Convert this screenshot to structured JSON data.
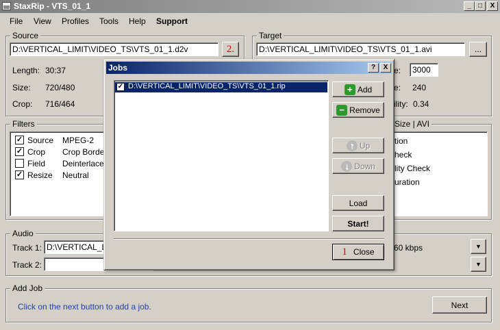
{
  "window": {
    "title": "StaxRip - VTS_01_1",
    "buttons": {
      "minimize": "_",
      "maximize": "□",
      "close": "X"
    }
  },
  "menu": [
    "File",
    "View",
    "Profiles",
    "Tools",
    "Help",
    "Support"
  ],
  "source": {
    "label": "Source",
    "path": "D:\\VERTICAL_LIMIT\\VIDEO_TS\\VTS_01_1.d2v",
    "browse_label": "2.",
    "length_label": "Length:",
    "length_value": "30:37",
    "size_label": "Size:",
    "size_value": "720/480",
    "crop_label": "Crop:",
    "crop_value": "716/464"
  },
  "target": {
    "label": "Target",
    "path": "D:\\VERTICAL_LIMIT\\VIDEO_TS\\VTS_01_1.avi",
    "browse_label": "...",
    "bitrate_label": "e:",
    "bitrate_value": "3000",
    "size_label": "e:",
    "size_value": "240",
    "quality_label": "ility:",
    "quality_value": "0.34"
  },
  "filters": {
    "label": "Filters",
    "items": [
      {
        "name": "Source",
        "value": "MPEG-2",
        "checked": "✓"
      },
      {
        "name": "Crop",
        "value": "Crop Borders",
        "checked": "✓"
      },
      {
        "name": "Field",
        "value": "Deinterlace",
        "checked": ""
      },
      {
        "name": "Resize",
        "value": "Neutral",
        "checked": "✓"
      }
    ]
  },
  "right_panel": {
    "label": "Size | AVI",
    "items": [
      "tion",
      "heck",
      "lity Check",
      "uration"
    ]
  },
  "audio": {
    "label": "Audio",
    "track1_label": "Track 1:",
    "track1_value": "D:\\VERTICAL_LI",
    "track1_bitrate": "60 kbps",
    "track2_label": "Track 2:",
    "track2_value": ""
  },
  "addjob": {
    "label": "Add Job",
    "hint": "Click on the next button to add a job.",
    "next_label": "Next"
  },
  "jobs_dialog": {
    "title": "Jobs",
    "help_label": "?",
    "close_x": "X",
    "jobs": [
      {
        "path": "D:\\VERTICAL_LIMIT\\VIDEO_TS\\VTS_01_1.rip",
        "checked": "✓"
      }
    ],
    "buttons": {
      "add": "Add",
      "remove": "Remove",
      "up": "Up",
      "down": "Down",
      "load": "Load",
      "start": "Start!",
      "close": "Close",
      "close_annotation": "1"
    }
  },
  "colors": {
    "selection": "#0a246a",
    "annotation": "#d40000",
    "hint": "#1f3fb0"
  }
}
